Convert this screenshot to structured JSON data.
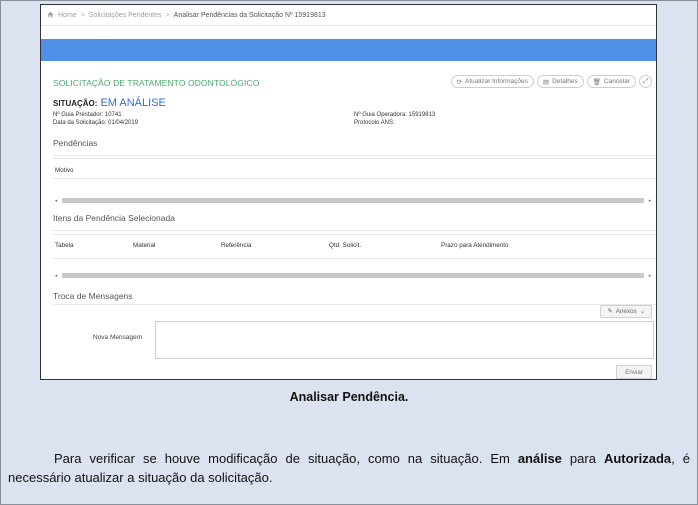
{
  "breadcrumb": {
    "home": "Home",
    "sep": ">",
    "pending": "Solicitações Pendentes",
    "current": "Analisar Pendências da Solicitação Nº 15919813"
  },
  "card": {
    "title": "SOLICITAÇÃO DE TRATAMENTO ODONTOLÓGICO",
    "actions": {
      "refresh": "Atualizar Informações",
      "details": "Detalhes",
      "cancel": "Cancelar"
    }
  },
  "status": {
    "label": "SITUAÇÃO:",
    "value": "EM ANÁLISE",
    "guia_prestador": "Nº Guia Prestador: 10741",
    "data_solicitacao": "Data da Solicitação: 01/04/2019",
    "guia_operadora": "Nº Guia Operadora: 15919813",
    "protocolo": "Protocolo ANS:"
  },
  "pendencias": {
    "title": "Pendências",
    "column": "Motivo"
  },
  "itens": {
    "title": "Itens da Pendência Selecionada",
    "columns": [
      "Tabela",
      "Material",
      "Referência",
      "Qtd. Solicit.",
      "Prazo para Atendimento"
    ]
  },
  "mensagens": {
    "title": "Troca de Mensagens",
    "anexos": "Anexos",
    "nova_label": "Nova Mensagem",
    "nova_value": "",
    "send": "Enviar"
  },
  "caption": "Analisar Pendência.",
  "paragraph": {
    "p1": "Para verificar se houve modificação de situação, como na situação. Em ",
    "b1": "análise",
    "p2": " para ",
    "b2": "Autorizada",
    "p3": ", é necessário atualizar a situação da solicitação."
  },
  "colors": {
    "accent_blue": "#4e8fe8",
    "title_green": "#4aa870",
    "status_blue": "#2f6fd6",
    "page_bg": "#dbe3f1"
  },
  "icons": [
    "home-icon",
    "refresh-icon",
    "details-icon",
    "trash-icon",
    "expand-icon",
    "paperclip-icon",
    "chevron-down-icon"
  ]
}
